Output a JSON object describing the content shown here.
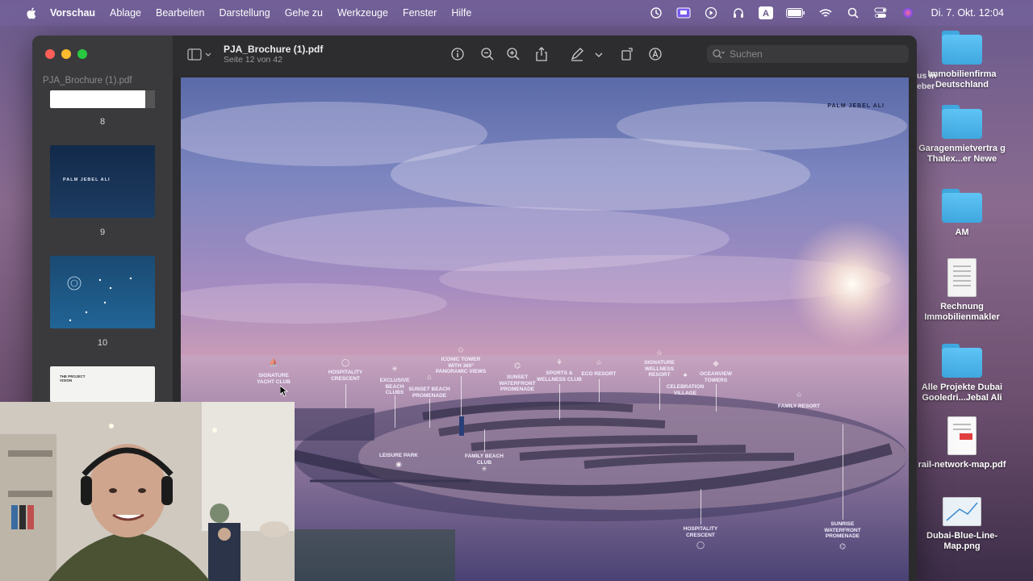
{
  "menubar": {
    "app_name": "Vorschau",
    "items": [
      "Ablage",
      "Bearbeiten",
      "Darstellung",
      "Gehe zu",
      "Werkzeuge",
      "Fenster",
      "Hilfe"
    ],
    "clock": "Di. 7. Okt.  12:04",
    "status_icons": [
      "screen-time-icon",
      "screen-mirroring-icon",
      "play-icon",
      "headphones-icon",
      "keyboard-input-icon",
      "battery-icon",
      "wifi-icon",
      "search-icon",
      "control-center-icon",
      "siri-icon"
    ]
  },
  "window": {
    "doc_title": "PJA_Brochure (1).pdf",
    "doc_subtitle": "Seite 12 von 42",
    "sidebar_title": "PJA_Brochure (1).pdf",
    "search_placeholder": "Suchen",
    "thumbnails": [
      {
        "page": "8"
      },
      {
        "page": "9",
        "text": "PALM JEBEL ALI"
      },
      {
        "page": "10"
      },
      {
        "text": "THE PROJECT VISION"
      }
    ],
    "toolbar_icons": [
      "info-icon",
      "zoom-out-icon",
      "zoom-in-icon",
      "share-icon",
      "markup-pen-icon",
      "chevron-down-icon",
      "rotate-icon",
      "annotate-icon",
      "form-fill-icon"
    ]
  },
  "pdf_page": {
    "brand": "PALM JEBEL ALI",
    "labels": {
      "yacht": "SIGNATURE YACHT CLUB",
      "hosp1": "HOSPITALITY CRESCENT",
      "beach": "EXCLUSIVE BEACH CLUBS",
      "promenade": "SUNSET BEACH PROMENADE",
      "tower": "ICONIC TOWER WITH 360° PANORAMIC VIEWS",
      "sunsetwf": "SUNSET WATERFRONT PROMENADE",
      "sports": "SPORTS & WELLNESS CLUB",
      "eco": "ECO RESORT",
      "wellness": "SIGNATURE WELLNESS RESORT",
      "celebration": "CELEBRATION VILLAGE",
      "oceanview": "OCEANVIEW TOWERS",
      "family": "FAMILY RESORT",
      "leisure": "LEISURE PARK",
      "familybeach": "FAMILY BEACH CLUB",
      "hosp2": "HOSPITALITY CRESCENT",
      "sunrise": "SUNRISE WATERFRONT PROMENADE"
    }
  },
  "desktop": {
    "icons": [
      {
        "label": "Immobilienfirma Deutschland",
        "type": "folder"
      },
      {
        "label": "Garagenmietvertra g Thalex...er Newe",
        "type": "folder"
      },
      {
        "label": "AM",
        "type": "folder"
      },
      {
        "label": "Rechnung Immobilienmakler",
        "type": "document"
      },
      {
        "label": "Alle Projekte Dubai Gooledri...Jebal Ali",
        "type": "folder"
      },
      {
        "label": "rail-network-map.pdf",
        "type": "pdf"
      },
      {
        "label": "Dubai-Blue-Line-Map.png",
        "type": "image"
      }
    ],
    "partial_text": [
      "us in",
      "eber"
    ]
  },
  "colors": {
    "menubar": "#7864a0",
    "folder_blue": "#3fa8e0",
    "close": "#ff5f57",
    "minimize": "#febc2e",
    "maximize": "#28c840"
  }
}
